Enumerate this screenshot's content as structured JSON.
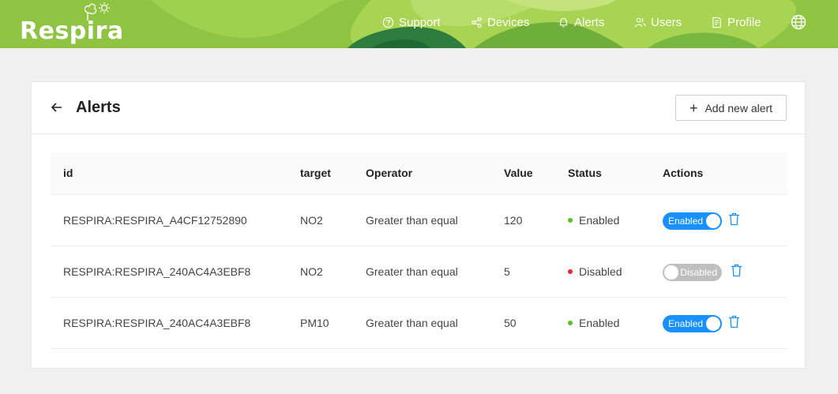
{
  "brand": {
    "name": "Respira",
    "header_color": "#8ec441"
  },
  "nav": [
    {
      "label": "Support",
      "icon": "help-circle-icon"
    },
    {
      "label": "Devices",
      "icon": "share-nodes-icon"
    },
    {
      "label": "Alerts",
      "icon": "bell-icon"
    },
    {
      "label": "Users",
      "icon": "users-icon"
    },
    {
      "label": "Profile",
      "icon": "profile-icon"
    }
  ],
  "language_icon": "globe-icon",
  "page": {
    "title": "Alerts",
    "add_button": "Add new alert"
  },
  "table": {
    "columns": [
      "id",
      "target",
      "Operator",
      "Value",
      "Status",
      "Actions"
    ],
    "rows": [
      {
        "id": "RESPIRA:RESPIRA_A4CF12752890",
        "target": "NO2",
        "operator": "Greater than equal",
        "value": "120",
        "status": "Enabled",
        "toggle": "Enabled",
        "enabled": true
      },
      {
        "id": "RESPIRA:RESPIRA_240AC4A3EBF8",
        "target": "NO2",
        "operator": "Greater than equal",
        "value": "5",
        "status": "Disabled",
        "toggle": "Disabled",
        "enabled": false
      },
      {
        "id": "RESPIRA:RESPIRA_240AC4A3EBF8",
        "target": "PM10",
        "operator": "Greater than equal",
        "value": "50",
        "status": "Enabled",
        "toggle": "Enabled",
        "enabled": true
      }
    ]
  },
  "colors": {
    "accent": "#1890ff",
    "enabled_dot": "#52c41a",
    "disabled_dot": "#f5222d",
    "toggle_off": "#bfbfbf"
  }
}
